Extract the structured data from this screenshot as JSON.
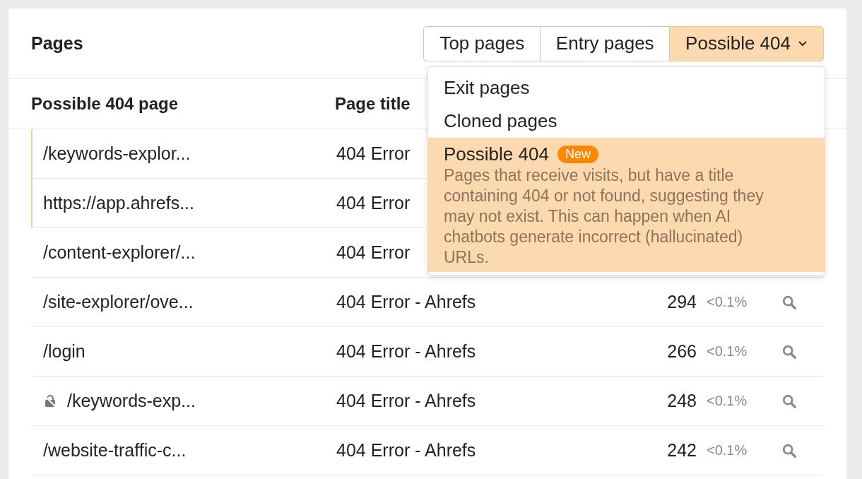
{
  "card": {
    "title": "Pages"
  },
  "segments": [
    {
      "label": "Top pages",
      "selected": false,
      "dropdown": false
    },
    {
      "label": "Entry pages",
      "selected": false,
      "dropdown": false
    },
    {
      "label": "Possible 404",
      "selected": true,
      "dropdown": true
    }
  ],
  "menu": {
    "items": [
      {
        "label": "Exit pages",
        "selected": false
      },
      {
        "label": "Cloned pages",
        "selected": false
      },
      {
        "label": "Possible 404",
        "selected": true,
        "badge": "New",
        "description": "Pages that receive visits, but have a title containing 404 or not found, suggesting they may not exist. This can happen when AI chatbots generate incorrect (hallucinated) URLs."
      }
    ]
  },
  "table": {
    "columns": [
      "Possible 404 page",
      "Page title"
    ],
    "rows": [
      {
        "page": "/keywords-explor...",
        "title": "404 Error",
        "highlighted": true,
        "locked": false
      },
      {
        "page": "https://app.ahrefs...",
        "title": "404 Error",
        "highlighted": true,
        "locked": false
      },
      {
        "page": "/content-explorer/...",
        "title": "404 Error",
        "highlighted": false,
        "locked": false
      },
      {
        "page": "/site-explorer/ove...",
        "title": "404 Error - Ahrefs",
        "visits": "294",
        "share": "<0.1%",
        "highlighted": false,
        "locked": false
      },
      {
        "page": "/login",
        "title": "404 Error - Ahrefs",
        "visits": "266",
        "share": "<0.1%",
        "highlighted": false,
        "locked": false
      },
      {
        "page": "/keywords-exp...",
        "title": "404 Error - Ahrefs",
        "visits": "248",
        "share": "<0.1%",
        "highlighted": false,
        "locked": true
      },
      {
        "page": "/website-traffic-c...",
        "title": "404 Error - Ahrefs",
        "visits": "242",
        "share": "<0.1%",
        "highlighted": false,
        "locked": false
      }
    ]
  }
}
